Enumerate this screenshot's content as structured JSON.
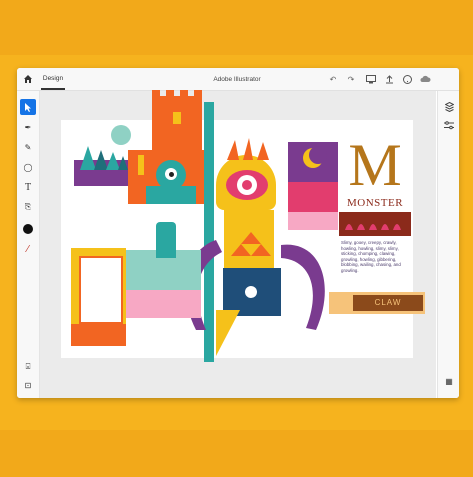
{
  "app": {
    "tab_label": "Design",
    "title": "Adobe Illustrator"
  },
  "artwork": {
    "big_letter": "M",
    "word": "MONSTER",
    "claw_label": "CLAW",
    "body_text": "Slimy, gooey, creepy, crawly, howling, howling, slimy, slimy, sticking, chomping, clawing, growling, howling, gibbering, blobbing, wailing, chasing, and growling."
  },
  "colors": {
    "accent": "#1473e6",
    "background": "#f6b31e",
    "orange": "#f26522",
    "teal": "#2aa7a1",
    "purple": "#7a3b8f",
    "yellow": "#f5c11a",
    "brown": "#8b4a1b"
  },
  "icons": {
    "home": "home-icon",
    "undo": "undo-icon",
    "redo": "redo-icon",
    "share": "share-icon",
    "help": "help-icon",
    "cloud": "cloud-icon",
    "layers": "layers-icon",
    "properties": "properties-icon"
  }
}
